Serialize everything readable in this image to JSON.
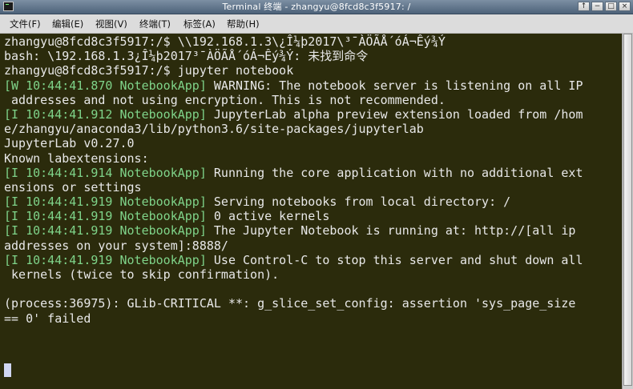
{
  "window": {
    "title": "Terminal 终端 - zhangyu@8fcd8c3f5917: /",
    "buttons": {
      "up": "↑",
      "minimize": "−",
      "maximize": "□",
      "close": "×"
    }
  },
  "menubar": {
    "items": [
      "文件(F)",
      "编辑(E)",
      "视图(V)",
      "终端(T)",
      "标签(A)",
      "帮助(H)"
    ]
  },
  "terminal": {
    "lines": [
      [
        {
          "t": "zhangyu@8fcd8c3f5917:/$ \\\\192.168.1.3\\¿Î¼þ2017\\³¯ÀÖÃÅ´óÁ¬Êý¾Ý"
        }
      ],
      [
        {
          "t": "bash: \\192.168.1.3¿Î¼þ2017³¯ÀÖÃÅ´óÁ¬Êý¾Ý: 未找到命令"
        }
      ],
      [
        {
          "t": "zhangyu@8fcd8c3f5917:/$ jupyter notebook"
        }
      ],
      [
        {
          "t": "[W 10:44:41.870 NotebookApp]",
          "g": true
        },
        {
          "t": " WARNING: The notebook server is listening on all IP"
        }
      ],
      [
        {
          "t": " addresses and not using encryption. This is not recommended."
        }
      ],
      [
        {
          "t": "[I 10:44:41.912 NotebookApp]",
          "g": true
        },
        {
          "t": " JupyterLab alpha preview extension loaded from /hom"
        }
      ],
      [
        {
          "t": "e/zhangyu/anaconda3/lib/python3.6/site-packages/jupyterlab"
        }
      ],
      [
        {
          "t": "JupyterLab v0.27.0"
        }
      ],
      [
        {
          "t": "Known labextensions:"
        }
      ],
      [
        {
          "t": "[I 10:44:41.914 NotebookApp]",
          "g": true
        },
        {
          "t": " Running the core application with no additional ext"
        }
      ],
      [
        {
          "t": "ensions or settings"
        }
      ],
      [
        {
          "t": "[I 10:44:41.919 NotebookApp]",
          "g": true
        },
        {
          "t": " Serving notebooks from local directory: /"
        }
      ],
      [
        {
          "t": "[I 10:44:41.919 NotebookApp]",
          "g": true
        },
        {
          "t": " 0 active kernels"
        }
      ],
      [
        {
          "t": "[I 10:44:41.919 NotebookApp]",
          "g": true
        },
        {
          "t": " The Jupyter Notebook is running at: http://[all ip"
        }
      ],
      [
        {
          "t": "addresses on your system]:8888/"
        }
      ],
      [
        {
          "t": "[I 10:44:41.919 NotebookApp]",
          "g": true
        },
        {
          "t": " Use Control-C to stop this server and shut down all"
        }
      ],
      [
        {
          "t": " kernels (twice to skip confirmation)."
        }
      ],
      [
        {
          "t": ""
        }
      ],
      [
        {
          "t": "(process:36975): GLib-CRITICAL **: g_slice_set_config: assertion 'sys_page_size"
        }
      ],
      [
        {
          "t": "== 0' failed"
        }
      ]
    ]
  }
}
